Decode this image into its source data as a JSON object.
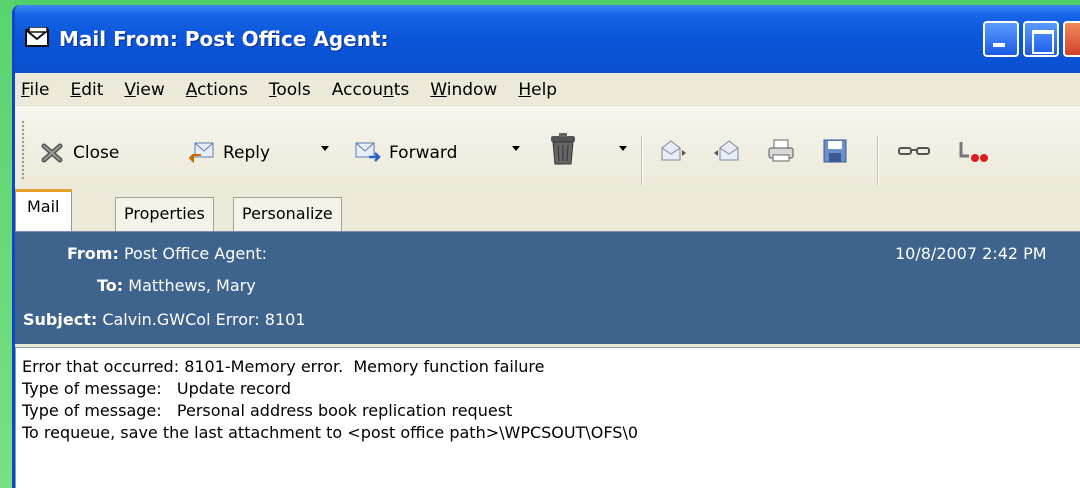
{
  "window": {
    "title": "Mail From: Post Office Agent:"
  },
  "menu": {
    "file": {
      "pre": "",
      "key": "F",
      "post": "ile"
    },
    "edit": {
      "pre": "",
      "key": "E",
      "post": "dit"
    },
    "view": {
      "pre": "",
      "key": "V",
      "post": "iew"
    },
    "actions": {
      "pre": "",
      "key": "A",
      "post": "ctions"
    },
    "tools": {
      "pre": "",
      "key": "T",
      "post": "ools"
    },
    "accounts": {
      "pre": "Accou",
      "key": "n",
      "post": "ts"
    },
    "window": {
      "pre": "",
      "key": "W",
      "post": "indow"
    },
    "help": {
      "pre": "",
      "key": "H",
      "post": "elp"
    }
  },
  "toolbar": {
    "close_label": "Close",
    "reply_label": "Reply",
    "forward_label": "Forward"
  },
  "tabs": [
    "Mail",
    "Properties",
    "Personalize"
  ],
  "header": {
    "from_label": "From:",
    "from_value": "Post Office Agent:",
    "to_label": "To:",
    "to_value": "Matthews, Mary",
    "subject_label": "Subject:",
    "subject_value": "Calvin.GWCol Error:  8101",
    "date": "10/8/2007 2:42 PM"
  },
  "body": {
    "lines": [
      "Error that occurred: 8101-Memory error.  Memory function failure",
      "Type of message:   Update record",
      "Type of message:   Personal address book replication request",
      "To requeue, save the last attachment to <post office path>\\WPCSOUT\\OFS\\0"
    ]
  },
  "colors": {
    "titlebar": "#0a51d3",
    "header_bg": "#3e638d",
    "active_tab_accent": "#e5a127",
    "background": "#59d873"
  }
}
